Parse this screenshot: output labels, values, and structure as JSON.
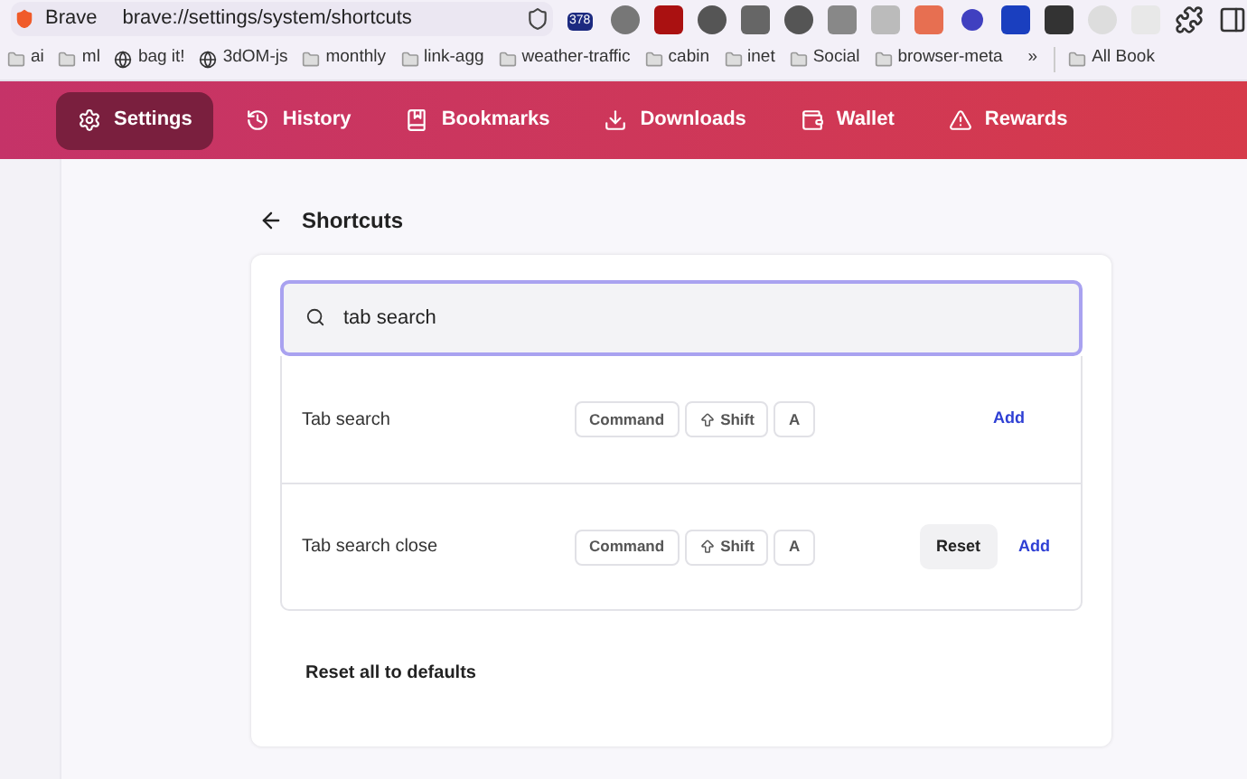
{
  "browser": {
    "tab_label": "Brave",
    "url": "brave://settings/system/shortcuts",
    "extension_badge": "378"
  },
  "bookmarks": [
    {
      "kind": "folder",
      "label": "ai"
    },
    {
      "kind": "folder",
      "label": "ml"
    },
    {
      "kind": "globe",
      "label": "bag it!"
    },
    {
      "kind": "globe",
      "label": "3dOM-js"
    },
    {
      "kind": "folder",
      "label": "monthly"
    },
    {
      "kind": "folder",
      "label": "link-agg"
    },
    {
      "kind": "folder",
      "label": "weather-traffic"
    },
    {
      "kind": "folder",
      "label": "cabin"
    },
    {
      "kind": "folder",
      "label": "inet"
    },
    {
      "kind": "folder",
      "label": "Social"
    },
    {
      "kind": "folder",
      "label": "browser-meta"
    }
  ],
  "bookmarks_overflow": "»",
  "all_bookmarks": "All Book",
  "nav": [
    {
      "label": "Settings",
      "selected": true
    },
    {
      "label": "History",
      "selected": false
    },
    {
      "label": "Bookmarks",
      "selected": false
    },
    {
      "label": "Downloads",
      "selected": false
    },
    {
      "label": "Wallet",
      "selected": false
    },
    {
      "label": "Rewards",
      "selected": false
    }
  ],
  "page": {
    "title": "Shortcuts",
    "search": {
      "value": "tab search"
    },
    "rows": [
      {
        "name": "Tab search",
        "keys": [
          {
            "kind": "plain",
            "label": "Command"
          },
          {
            "kind": "shift",
            "label": "Shift"
          },
          {
            "kind": "plain",
            "label": "A"
          }
        ],
        "reset": null,
        "add": "Add"
      },
      {
        "name": "Tab search close",
        "keys": [
          {
            "kind": "plain",
            "label": "Command"
          },
          {
            "kind": "shift",
            "label": "Shift"
          },
          {
            "kind": "plain",
            "label": "A"
          }
        ],
        "reset": "Reset",
        "add": "Add"
      }
    ],
    "reset_all": "Reset all to defaults"
  }
}
